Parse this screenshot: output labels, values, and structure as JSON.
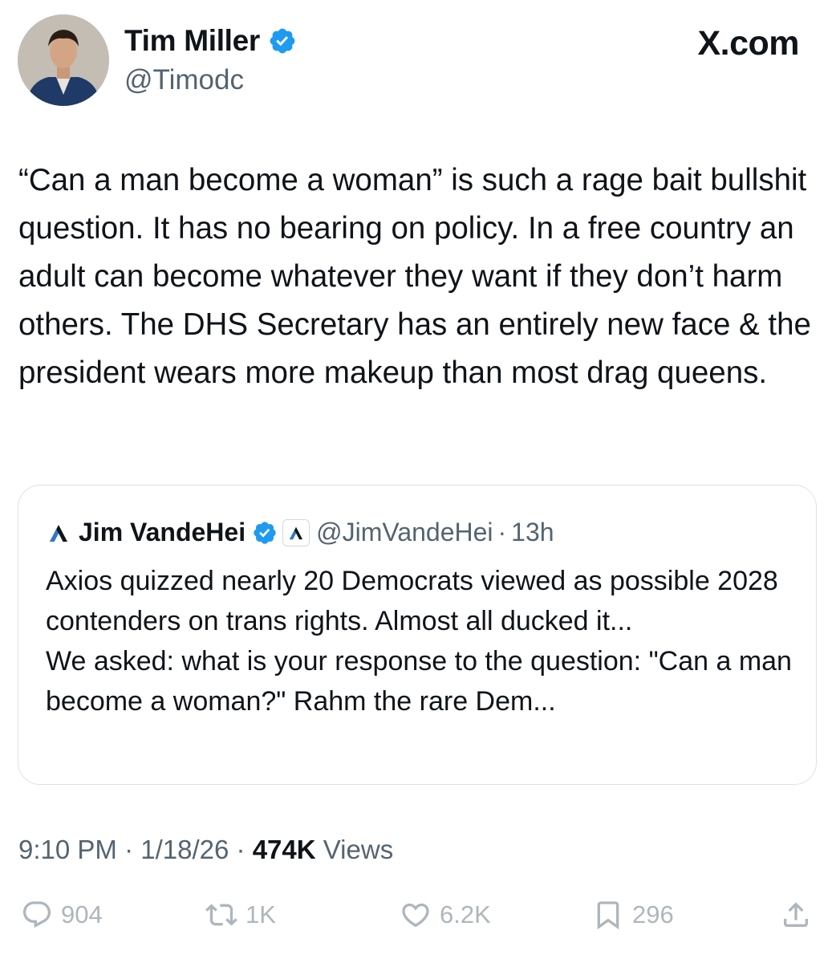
{
  "author": {
    "name": "Tim Miller",
    "handle": "@Timodc",
    "verified": true
  },
  "site": "X.com",
  "tweet": {
    "text": "“Can a man become a woman” is such a rage bait bullshit question. It has no bearing on policy. In a free country an adult can become whatever they want if they don’t harm others. The DHS Secretary has an entirely new face & the president wears more makeup than most drag queens."
  },
  "quoted": {
    "name": "Jim VandeHei",
    "handle": "@JimVandeHei",
    "time": "13h",
    "text_line1": "Axios quizzed nearly 20 Democrats viewed as possible 2028 contenders on trans rights. Almost all ducked it...",
    "text_line2": "We asked: what is your response to the question: \"Can a man become a woman?\" Rahm the rare Dem..."
  },
  "meta": {
    "time": "9:10 PM",
    "date": "1/18/26",
    "views_count": "474K",
    "views_label": "Views"
  },
  "actions": {
    "replies": "904",
    "reposts": "1K",
    "likes": "6.2K",
    "bookmarks": "296"
  },
  "colors": {
    "verified": "#1d9bf0",
    "secondary_text": "#536471",
    "faded_icons": "#aeb6bd"
  }
}
